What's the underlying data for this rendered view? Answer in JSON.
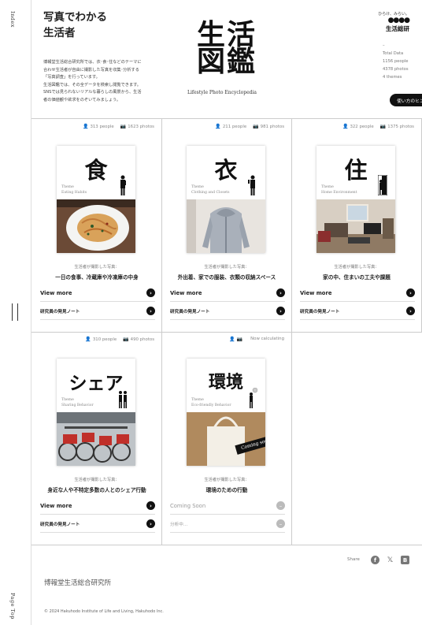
{
  "side": {
    "index_label": "Index",
    "pagetop_label": "Page Top"
  },
  "header": {
    "tagline_line1": "写真でわかる",
    "tagline_line2": "生活者",
    "description": [
      "博報堂生活総合研究所では、衣･食･住などのテーマに",
      "合わせ生活者が自由に撮影した写真を収集･分析する",
      "「写真調査」を行っています。",
      "生活図鑑では、その全データを検索し閲覧できます。",
      "SNSでは見られないリアルな暮らしの風景から、生活",
      "者の価値観や欲求をのぞいてみましょう。"
    ],
    "logo_line1": "生活",
    "logo_line2": "図鑑",
    "logo_sub": "Lifestyle Photo Encyclopedia",
    "brand_small": "ひらけ、みらい。",
    "brand_dots": "●●●●",
    "brand_name": "生活総研",
    "stats_dash": "–",
    "stats_title": "Total Data",
    "stats_people": "1156 people",
    "stats_photos": "4378 photos",
    "stats_themes": "4 themes",
    "hint_label": "使い方のヒント",
    "hint_icon": "?"
  },
  "cells": [
    {
      "people": "313 people",
      "photos": "1623 photos",
      "kanji": "食",
      "theme_label": "Theme",
      "theme_en": "Eating Habits",
      "caption": "生活者が撮影した写真：",
      "desc": "一日の食事、冷蔵庫や冷凍庫の中身",
      "view": "View more",
      "note": "研究員の発見ノート"
    },
    {
      "people": "211 people",
      "photos": "981 photos",
      "kanji": "衣",
      "theme_label": "Theme",
      "theme_en": "Clothing and Closets",
      "caption": "生活者が撮影した写真：",
      "desc": "外出着、家での服装、衣類の収納スペース",
      "view": "View more",
      "note": "研究員の発見ノート"
    },
    {
      "people": "322 people",
      "photos": "1375 photos",
      "kanji": "住",
      "theme_label": "Theme",
      "theme_en": "Home Environment",
      "caption": "生活者が撮影した写真：",
      "desc": "家の中、住まいの工夫や課題",
      "view": "View more",
      "note": "研究員の発見ノート"
    },
    {
      "people": "310 people",
      "photos": "490 photos",
      "kanji": "シェア",
      "theme_label": "Theme",
      "theme_en": "Sharing Behavior",
      "caption": "生活者が撮影した写真：",
      "desc": "身近な人や不特定多数の人とのシェア行動",
      "view": "View more",
      "note": "研究員の発見ノート"
    },
    {
      "people": "",
      "photos": "Now calculating",
      "kanji": "環境",
      "theme_label": "Theme",
      "theme_en": "Eco-friendly Behavior",
      "caption": "生活者が撮影した写真：",
      "desc": "環境のための行動",
      "view": "Coming Soon",
      "note": "分析中…",
      "ribbon": "Coming soon"
    }
  ],
  "footer": {
    "share_label": "Share",
    "org_name": "博報堂生活総合研究所",
    "copyright": "© 2024 Hakuhodo Institute of Life and Living, Hakuhodo Inc."
  }
}
